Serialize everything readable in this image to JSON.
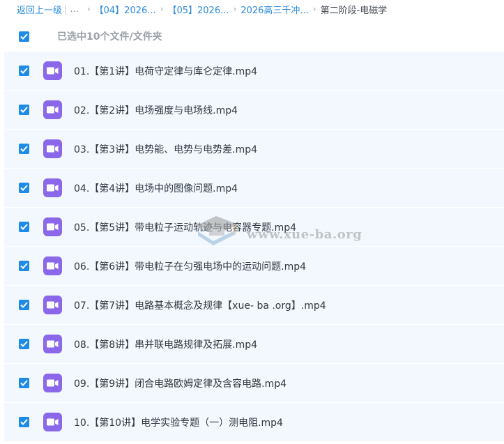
{
  "breadcrumb": {
    "back": "返回上一级",
    "separator_bar": "|",
    "ellipsis": "...",
    "crumbs": [
      "【04】2026...",
      "【05】2026...",
      "2026高三千冲..."
    ],
    "chevron": "›",
    "current": "第二阶段-电磁学"
  },
  "selection": {
    "count_label": "已选中10个文件/文件夹",
    "checked": true
  },
  "files": [
    {
      "name": "01.【第1讲】电荷守定律与库仑定律.mp4",
      "checked": true
    },
    {
      "name": "02.【第2讲】电场强度与电场线.mp4",
      "checked": true
    },
    {
      "name": "03.【第3讲】电势能、电势与电势差.mp4",
      "checked": true
    },
    {
      "name": "04.【第4讲】电场中的图像问题.mp4",
      "checked": true
    },
    {
      "name": "05.【第5讲】带电粒子运动轨迹与电容器专题.mp4",
      "checked": true
    },
    {
      "name": "06.【第6讲】带电粒子在匀强电场中的运动问题.mp4",
      "checked": true
    },
    {
      "name": "07.【第7讲】电路基本概念及规律【xue- ba .org】.mp4",
      "checked": true
    },
    {
      "name": "08.【第8讲】串并联电路规律及拓展.mp4",
      "checked": true
    },
    {
      "name": "09.【第9讲】闭合电路欧姆定律及含容电路.mp4",
      "checked": true
    },
    {
      "name": "10.【第10讲】电学实验专题（一）测电阻.mp4",
      "checked": true
    }
  ],
  "watermark": {
    "text": "www.xue-ba.org"
  },
  "icons": {
    "checkbox": "checkmark-icon",
    "file": "video-file-icon",
    "watermark_logo": "graduation-cap-icon"
  },
  "colors": {
    "accent": "#1e8be6",
    "link": "#2a8bdc",
    "row_bg": "#f2f8fe",
    "video_icon": "#8b68ea"
  }
}
